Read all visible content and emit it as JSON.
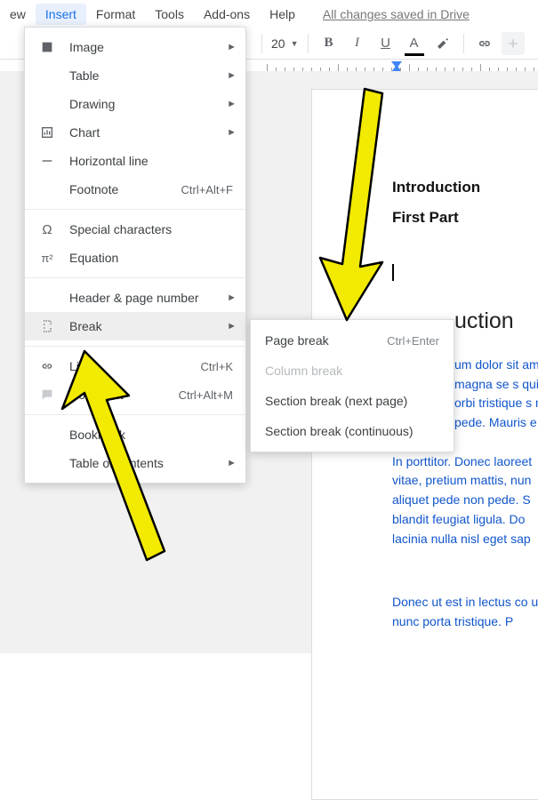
{
  "menubar": {
    "items": [
      "ew",
      "Insert",
      "Format",
      "Tools",
      "Add-ons",
      "Help"
    ],
    "active_index": 1
  },
  "save_status": "All changes saved in Drive",
  "toolbar": {
    "font_size": "20",
    "bold": "B",
    "italic": "I",
    "underline": "U",
    "text_color": "A"
  },
  "insert_menu": {
    "items": [
      {
        "icon": "image",
        "label": "Image",
        "submenu": true
      },
      {
        "icon": "",
        "label": "Table",
        "submenu": true
      },
      {
        "icon": "",
        "label": "Drawing",
        "submenu": true
      },
      {
        "icon": "chart",
        "label": "Chart",
        "submenu": true
      },
      {
        "icon": "hr",
        "label": "Horizontal line"
      },
      {
        "icon": "",
        "label": "Footnote",
        "shortcut": "Ctrl+Alt+F"
      },
      {
        "sep": true
      },
      {
        "icon": "omega",
        "label": "Special characters"
      },
      {
        "icon": "pi",
        "label": "Equation"
      },
      {
        "sep": true
      },
      {
        "icon": "",
        "label": "Header & page number",
        "submenu": true
      },
      {
        "icon": "break",
        "label": "Break",
        "submenu": true,
        "highlight": true
      },
      {
        "sep": true
      },
      {
        "icon": "link",
        "label": "Link",
        "shortcut": "Ctrl+K"
      },
      {
        "icon": "comment",
        "label": "Comment",
        "shortcut": "Ctrl+Alt+M"
      },
      {
        "sep": true
      },
      {
        "icon": "",
        "label": "Bookmark"
      },
      {
        "icon": "",
        "label": "Table of contents",
        "submenu": true
      }
    ]
  },
  "break_submenu": {
    "items": [
      {
        "label": "Page break",
        "shortcut": "Ctrl+Enter"
      },
      {
        "label": "Column break",
        "disabled": true
      },
      {
        "label": "Section break (next page)"
      },
      {
        "label": "Section break (continuous)"
      }
    ]
  },
  "document": {
    "h_intro": "Introduction",
    "h_first": "First Part",
    "h_intro2": "uction",
    "para1": "um dolor sit am, uere, magna se s quis urna. Nu orbi tristique s nonummy pede. Mauris e",
    "para2": "In porttitor. Donec laoreet vitae, pretium mattis, nun aliquet pede non pede. S blandit feugiat ligula. Do lacinia nulla nisl eget sap",
    "para3": "Donec ut est in lectus co ut nunc porta tristique. P"
  }
}
